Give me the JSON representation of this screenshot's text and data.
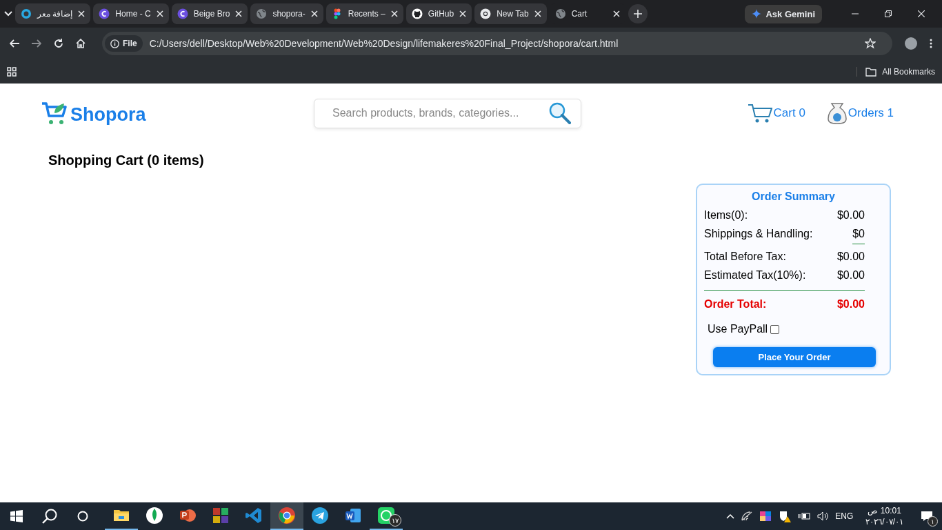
{
  "browser": {
    "tabs": [
      {
        "kind": "ring",
        "label": "إضافة معر",
        "selected": false
      },
      {
        "kind": "canva",
        "label": "Home - C",
        "selected": false
      },
      {
        "kind": "canva",
        "label": "Beige Bro",
        "selected": false
      },
      {
        "kind": "globe",
        "label": "shopora-",
        "selected": false
      },
      {
        "kind": "figma",
        "label": "Recents –",
        "selected": false
      },
      {
        "kind": "github",
        "label": "GitHub",
        "selected": false
      },
      {
        "kind": "chrome",
        "label": "New Tab",
        "selected": false
      },
      {
        "kind": "globe",
        "label": "Cart",
        "selected": true
      }
    ],
    "gemini": "Ask Gemini",
    "address": {
      "chip": "File",
      "url": "C:/Users/dell/Desktop/Web%20Development/Web%20Design/lifemakeres%20Final_Project/shopora/cart.html"
    },
    "bookmarks": "All Bookmarks"
  },
  "site": {
    "logo": "Shopora",
    "search": {
      "placeholder": "Search products, brands, categories..."
    },
    "nav": [
      {
        "kind": "cart",
        "label": "Cart 0"
      },
      {
        "kind": "orders",
        "label": "Orders 1"
      }
    ],
    "heading": "Shopping Cart (0 items)",
    "summary": {
      "title": "Order Summary",
      "rows": [
        {
          "kind": "normal",
          "label": "Items(0):",
          "value": "$0.00",
          "underlined": false
        },
        {
          "kind": "normal",
          "label": "Shippings & Handling:",
          "value": "$0",
          "underlined": true
        },
        {
          "kind": "normal",
          "label": "Total Before Tax:",
          "value": "$0.00",
          "underlined": false
        },
        {
          "kind": "normal",
          "label": "Estimated Tax(10%):",
          "value": "$0.00",
          "underlined": false
        },
        {
          "kind": "total",
          "label": "Order Total:",
          "value": "$0.00",
          "underlined": false
        }
      ],
      "paypal": {
        "label": "Use PayPall",
        "checked": false
      },
      "button": "Place Your Order"
    }
  },
  "taskbar": {
    "apps": [
      {
        "kind": "explorer",
        "running": true,
        "selected": false
      },
      {
        "kind": "mongo",
        "running": false,
        "selected": false
      },
      {
        "kind": "powerpoint",
        "running": false,
        "selected": false
      },
      {
        "kind": "blocks",
        "running": false,
        "selected": false
      },
      {
        "kind": "vscode",
        "running": false,
        "selected": false
      },
      {
        "kind": "chrome",
        "running": true,
        "selected": true
      },
      {
        "kind": "telegram",
        "running": false,
        "selected": false
      },
      {
        "kind": "word",
        "running": false,
        "selected": false
      },
      {
        "kind": "whatsapp",
        "running": true,
        "selected": false,
        "badge": "١٧"
      }
    ],
    "lang": "ENG",
    "time": "10:01 ص",
    "date": "٢٠٢٦/٠٧/٠١",
    "notifications": "١"
  }
}
